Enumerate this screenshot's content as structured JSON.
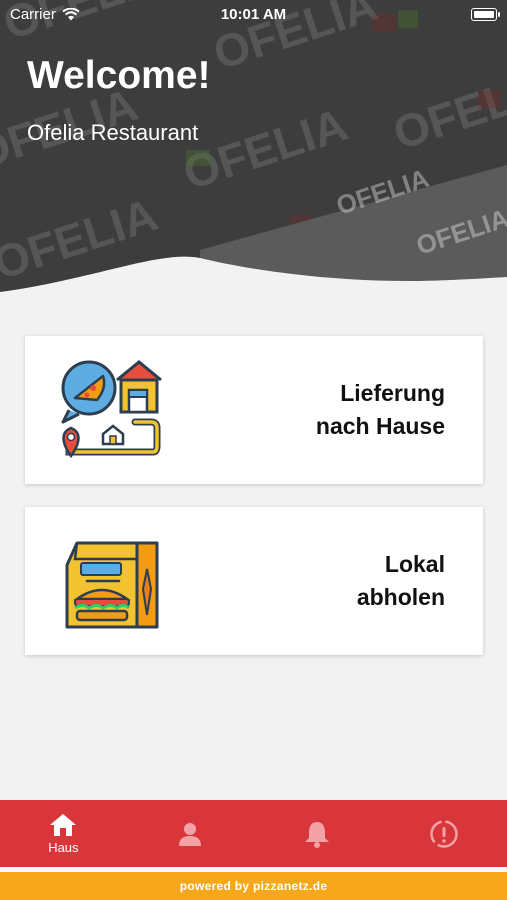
{
  "status_bar": {
    "carrier": "Carrier",
    "time": "10:01 AM"
  },
  "header": {
    "title": "Welcome!",
    "subtitle": "Ofelia Restaurant",
    "background_watermark": "OFELIA"
  },
  "options": [
    {
      "line1": "Lieferung",
      "line2": "nach Hause",
      "icon": "delivery-map-icon"
    },
    {
      "line1": "Lokal",
      "line2": "abholen",
      "icon": "takeaway-bag-icon"
    }
  ],
  "tabbar": {
    "tabs": [
      {
        "label": "Haus",
        "icon": "home-icon",
        "active": true
      },
      {
        "label": "",
        "icon": "user-icon",
        "active": false
      },
      {
        "label": "",
        "icon": "bell-icon",
        "active": false
      },
      {
        "label": "",
        "icon": "info-icon",
        "active": false
      }
    ]
  },
  "footer": {
    "text": "powered by pizzanetz.de"
  },
  "colors": {
    "tabbar": "#d9363c",
    "footer": "#f6a81a",
    "header": "#3f3f3f"
  }
}
